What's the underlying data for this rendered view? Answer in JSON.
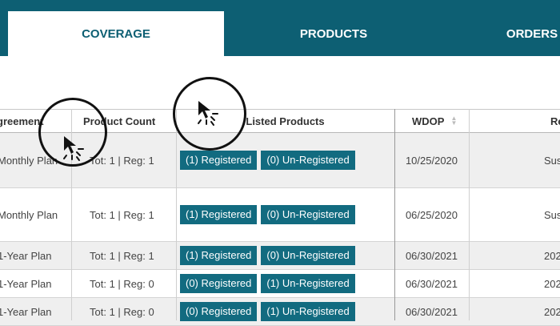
{
  "tabs": [
    {
      "label": "COVERAGE",
      "active": true
    },
    {
      "label": "PRODUCTS",
      "active": false
    },
    {
      "label": "ORDERS",
      "active": false
    }
  ],
  "table": {
    "headers": {
      "agreement": "greement",
      "product_count": "Product Count",
      "listed_products": "Listed Products",
      "wdop": "WDOP",
      "last": "Re"
    },
    "rows": [
      {
        "agreement": "Monthly Plan",
        "count": "Tot: 1 | Reg: 1",
        "registered": "(1) Registered",
        "unregistered": "(0) Un-Registered",
        "wdop": "10/25/2020",
        "last": "Sus"
      },
      {
        "agreement": "Monthly Plan",
        "count": "Tot: 1 | Reg: 1",
        "registered": "(1) Registered",
        "unregistered": "(0) Un-Registered",
        "wdop": "06/25/2020",
        "last": "Sus"
      },
      {
        "agreement": "1-Year Plan",
        "count": "Tot: 1 | Reg: 1",
        "registered": "(1) Registered",
        "unregistered": "(0) Un-Registered",
        "wdop": "06/30/2021",
        "last": "202"
      },
      {
        "agreement": "1-Year Plan",
        "count": "Tot: 1 | Reg: 0",
        "registered": "(0) Registered",
        "unregistered": "(1) Un-Registered",
        "wdop": "06/30/2021",
        "last": "202"
      },
      {
        "agreement": "1-Year Plan",
        "count": "Tot: 1 | Reg: 0",
        "registered": "(0) Registered",
        "unregistered": "(1) Un-Registered",
        "wdop": "06/30/2021",
        "last": "202"
      }
    ]
  },
  "colors": {
    "accent": "#0d5f73",
    "badge": "#126b80"
  },
  "icons": {
    "cursor": "click-cursor-icon",
    "sort": "sort-arrows-icon"
  }
}
